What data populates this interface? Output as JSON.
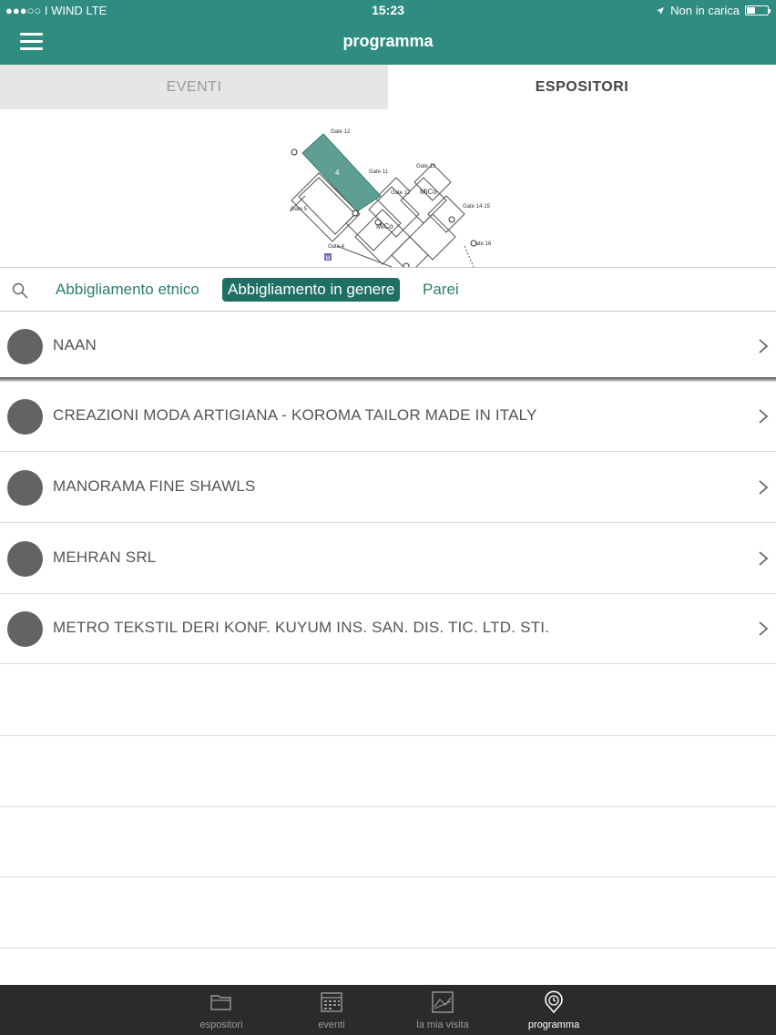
{
  "status_bar": {
    "carrier": "●●●○○ I WIND   LTE",
    "time": "15:23",
    "right": "Non in carica"
  },
  "header": {
    "title": "programma"
  },
  "tabs": [
    {
      "label": "EVENTI",
      "active": false
    },
    {
      "label": "ESPOSITORI",
      "active": true
    }
  ],
  "map": {
    "labels": [
      "Gate 12",
      "Gate 11",
      "Gate 12",
      "Gate 13",
      "MiCo",
      "Gate 14-15",
      "Gate 5",
      "MiCo",
      "Gate 4",
      "Gate 16",
      "4",
      "M"
    ]
  },
  "filters": {
    "chips": [
      {
        "label": "Abbigliamento etnico",
        "selected": false
      },
      {
        "label": "Abbigliamento in genere",
        "selected": true
      },
      {
        "label": "Parei",
        "selected": false
      }
    ]
  },
  "exhibitors": [
    {
      "name": "NAAN"
    },
    {
      "name": "CREAZIONI MODA ARTIGIANA - KOROMA TAILOR MADE IN ITALY"
    },
    {
      "name": "MANORAMA FINE SHAWLS"
    },
    {
      "name": "MEHRAN SRL"
    },
    {
      "name": "METRO TEKSTIL DERI KONF. KUYUM INS. SAN. DIS. TIC. LTD. STI."
    }
  ],
  "tabbar": {
    "items": [
      {
        "label": "espositori",
        "icon": "folder-icon",
        "active": false
      },
      {
        "label": "eventi",
        "icon": "calendar-icon",
        "active": false
      },
      {
        "label": "la mia visita",
        "icon": "map-icon",
        "active": false
      },
      {
        "label": "programma",
        "icon": "clock-pin-icon",
        "active": true
      }
    ]
  },
  "colors": {
    "primary": "#2f8c80",
    "chip_selected": "#1f6f64",
    "map_highlight": "#5f9e93",
    "tabbar": "#2b2b2b"
  }
}
